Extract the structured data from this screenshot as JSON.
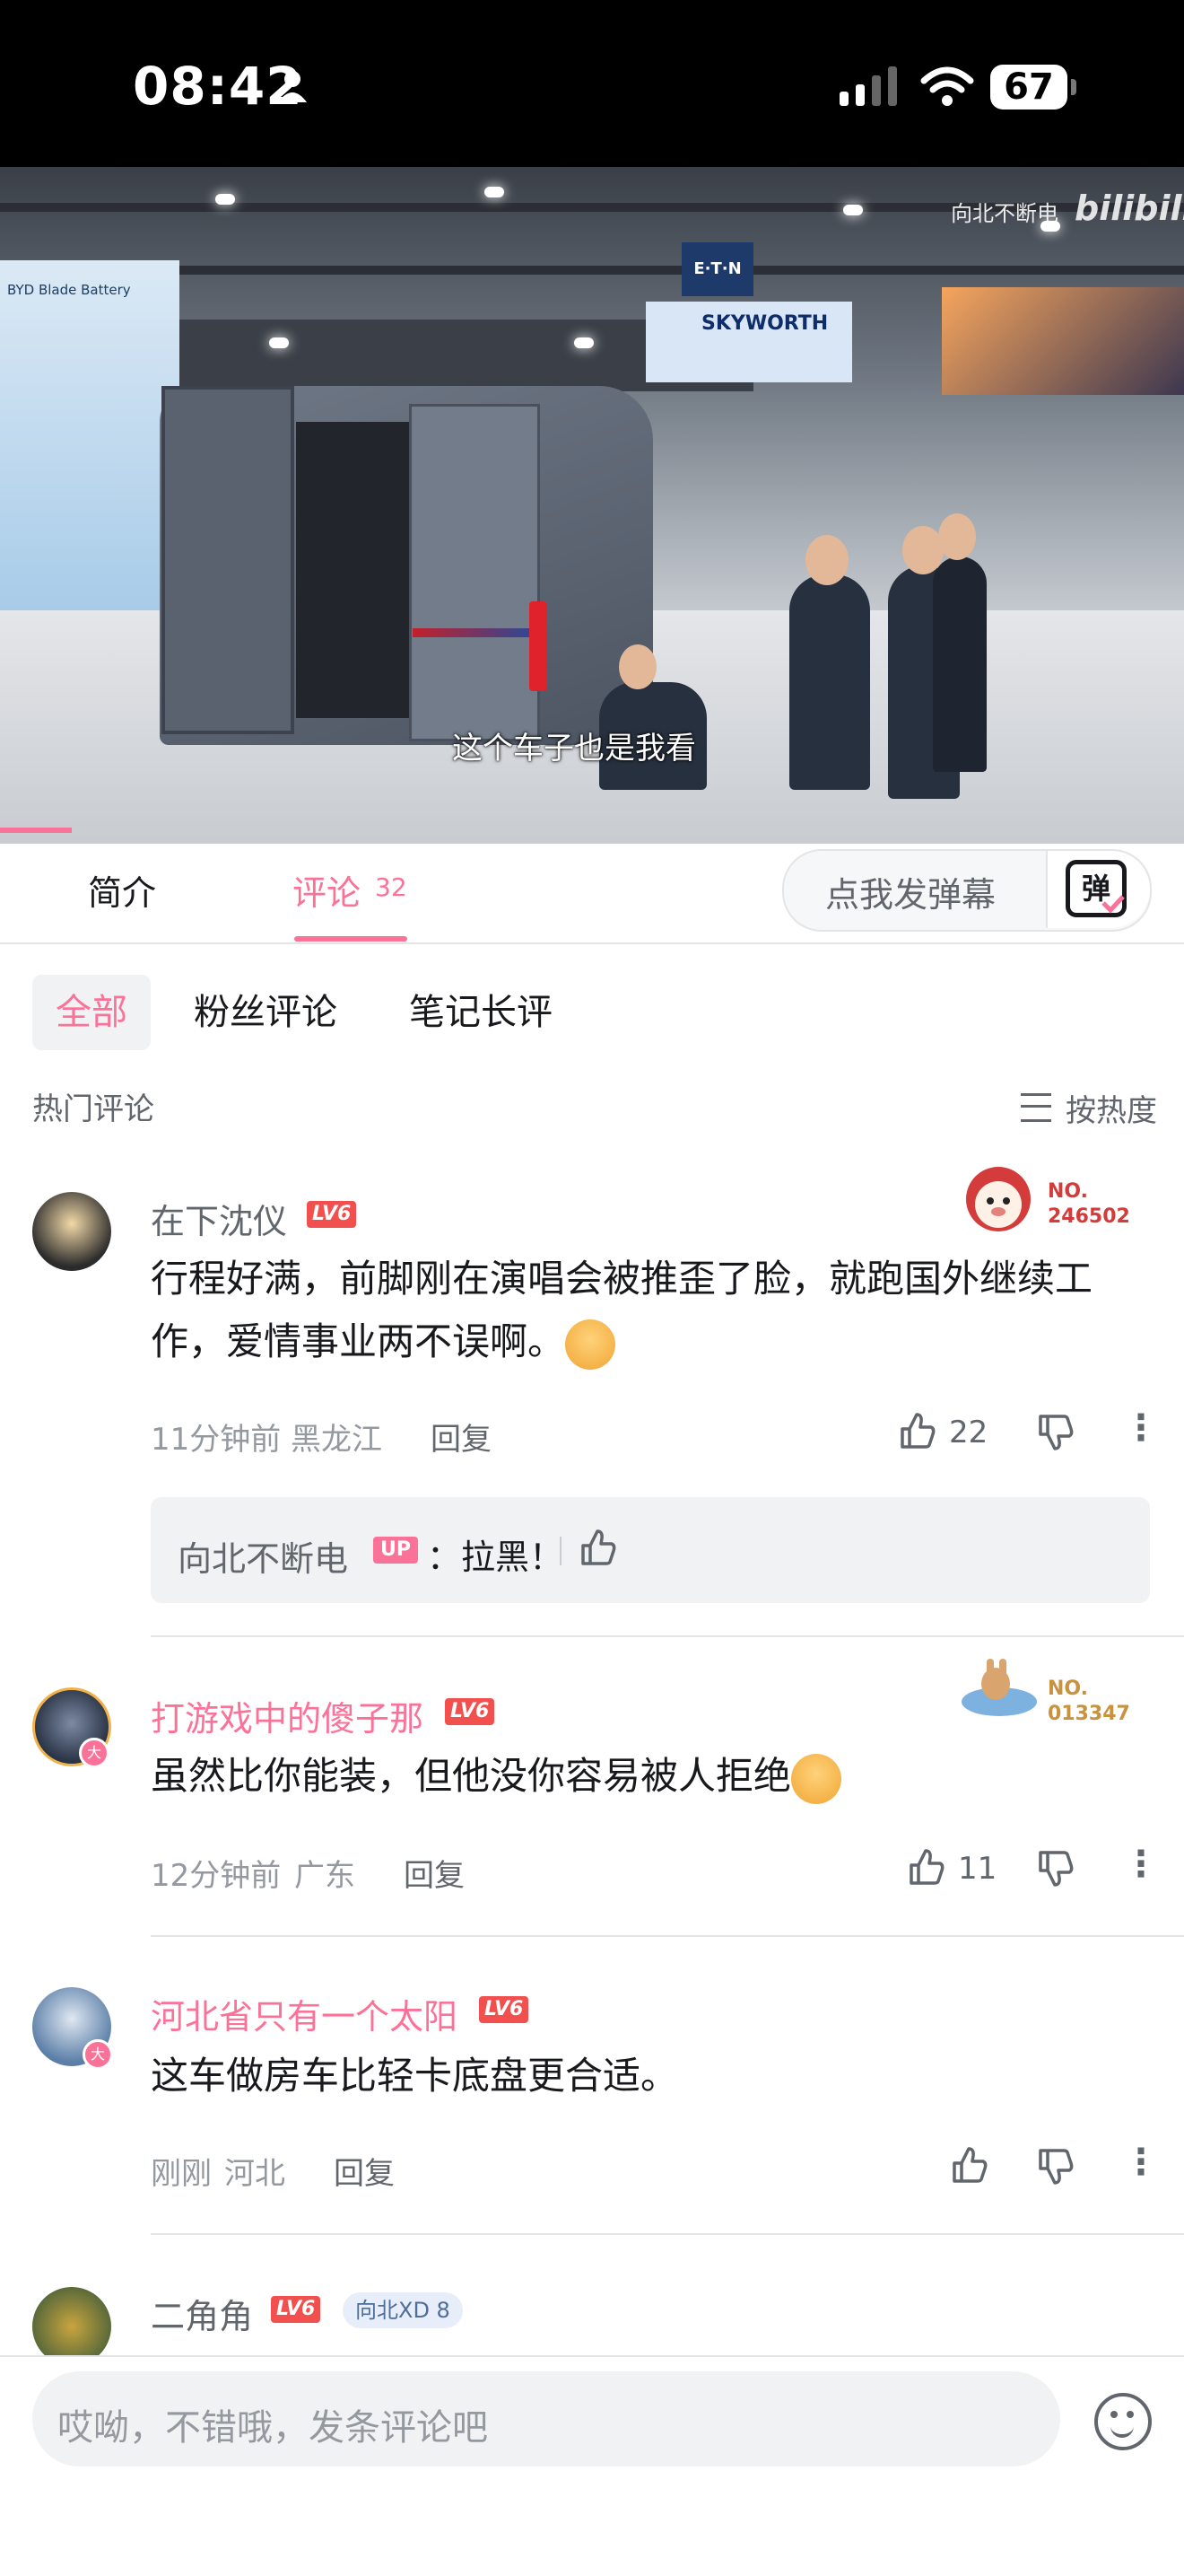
{
  "status_bar": {
    "time": "08:42",
    "battery": "67"
  },
  "video": {
    "watermark": "向北不断电",
    "brand": "bilibili",
    "subtitle": "这个车子也是我看",
    "signs": {
      "left_booth": "BYD Blade Battery",
      "eaton": "E·T·N",
      "skyworth": "SKYWORTH"
    }
  },
  "tabs": {
    "intro": "简介",
    "comments": "评论",
    "comment_count": "32",
    "danmaku_placeholder": "点我发弹幕",
    "danmaku_icon": "弹"
  },
  "filters": {
    "all": "全部",
    "fans": "粉丝评论",
    "notes": "笔记长评"
  },
  "section": {
    "hot": "热门评论",
    "sort": "按热度"
  },
  "comments": [
    {
      "user": "在下沈仪",
      "level": "LV6",
      "fan_no": "NO.\n246502",
      "text": "行程好满，前脚刚在演唱会被推歪了脸，就跑国外继续工作，爱情事业两不误啊。",
      "time": "11分钟前",
      "location": "黑龙江",
      "reply": "回复",
      "likes": "22",
      "sub_reply": {
        "user": "向北不断电",
        "badge": "UP",
        "text": "：拉黑！"
      }
    },
    {
      "user": "打游戏中的傻子那",
      "level": "LV6",
      "fan_no": "NO.\n013347",
      "verified": "大",
      "text": "虽然比你能装，但他没你容易被人拒绝",
      "time": "12分钟前",
      "location": "广东",
      "reply": "回复",
      "likes": "11"
    },
    {
      "user": "河北省只有一个太阳",
      "level": "LV6",
      "verified": "大",
      "text": "这车做房车比轻卡底盘更合适。",
      "time": "刚刚",
      "location": "河北",
      "reply": "回复"
    },
    {
      "user": "二角角",
      "level": "LV6",
      "badge": "向北XD 8"
    }
  ],
  "input": {
    "placeholder": "哎呦，不错哦，发条评论吧"
  },
  "colors": {
    "accent": "#fb7299",
    "level_red": "#f24f4f",
    "level_ring": "#fb7299"
  }
}
